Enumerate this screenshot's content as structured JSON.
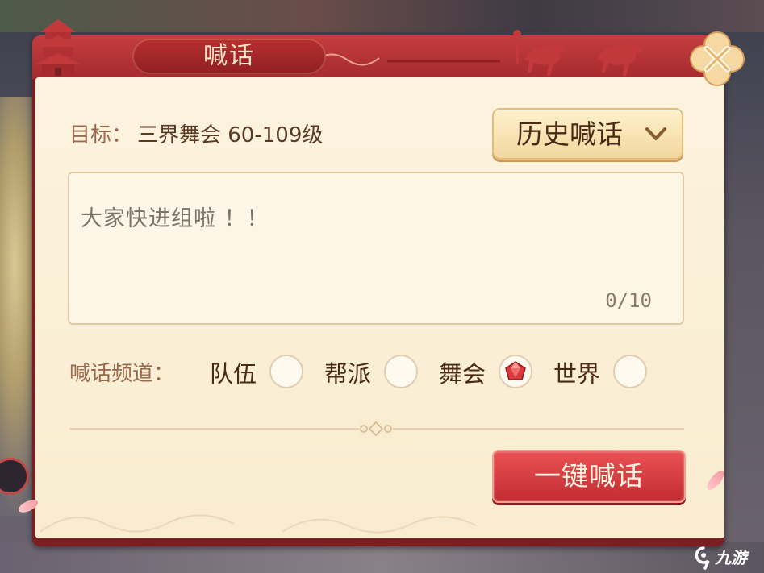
{
  "dialog": {
    "title": "喊话",
    "close_icon": "close-icon"
  },
  "target": {
    "label": "目标：",
    "value": "三界舞会 60-109级"
  },
  "history_button": {
    "label": "历史喊话",
    "icon": "chevron-down-icon"
  },
  "message": {
    "text": "大家快进组啦 ！！",
    "counter": "0/10"
  },
  "channels": {
    "label": "喊话频道：",
    "options": [
      {
        "label": "队伍",
        "selected": false
      },
      {
        "label": "帮派",
        "selected": false
      },
      {
        "label": "舞会",
        "selected": true
      },
      {
        "label": "世界",
        "selected": false
      }
    ]
  },
  "shout_button": {
    "label": "一键喊话"
  },
  "watermark": {
    "text": "九游"
  },
  "colors": {
    "header_red": "#a52a2e",
    "panel_bg": "#fcf3df",
    "button_red": "#c22d32",
    "accent_gold": "#f2d79f"
  }
}
